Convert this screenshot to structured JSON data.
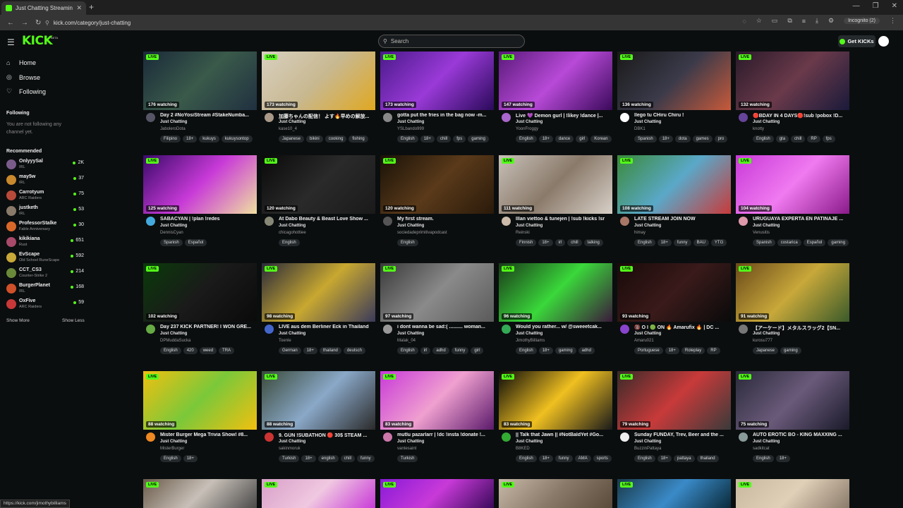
{
  "browser": {
    "tab_title": "Just Chatting Streaming - Live",
    "url": "kick.com/category/just-chatting",
    "incognito": "Incognito (2)",
    "status_url": "https://kick.com/jimothybilliams"
  },
  "header": {
    "logo": "KICK",
    "beta": "BETA",
    "search_placeholder": "Search",
    "get_kicks": "Get KICKs"
  },
  "sidebar": {
    "nav": [
      {
        "label": "Home",
        "icon": "home-icon",
        "glyph": "⌂"
      },
      {
        "label": "Browse",
        "icon": "browse-icon",
        "glyph": "◎"
      },
      {
        "label": "Following",
        "icon": "heart-icon",
        "glyph": "♡"
      }
    ],
    "following_title": "Following",
    "following_empty": "You are not following any channel yet.",
    "recommended_title": "Recommended",
    "recommended": [
      {
        "name": "OnlyyySal",
        "category": "IRL",
        "viewers": "2K",
        "color": "#7a5c8a"
      },
      {
        "name": "may5w",
        "category": "IRL",
        "viewers": "37",
        "color": "#c9892c"
      },
      {
        "name": "Carrotyum",
        "category": "ARC Raiders",
        "viewers": "75",
        "color": "#b84a3a"
      },
      {
        "name": "justketh",
        "category": "IRL",
        "viewers": "53",
        "color": "#8a7a6a"
      },
      {
        "name": "ProfessorStalke",
        "category": "Fable Anniversary",
        "viewers": "30",
        "color": "#d8682a"
      },
      {
        "name": "kikikiana",
        "category": "Rust",
        "viewers": "651",
        "color": "#a84a6a"
      },
      {
        "name": "EvScape",
        "category": "Old School RuneScape",
        "viewers": "592",
        "color": "#c8a838"
      },
      {
        "name": "CCT_CS3",
        "category": "Counter-Strike 2",
        "viewers": "214",
        "color": "#6a8a3a"
      },
      {
        "name": "BurgerPlanet",
        "category": "IRL",
        "viewers": "168",
        "color": "#d0502a"
      },
      {
        "name": "OxFive",
        "category": "ARC Raiders",
        "viewers": "59",
        "color": "#c83838"
      }
    ],
    "show_more": "Show More",
    "show_less": "Show Less"
  },
  "labels": {
    "live": "LIVE"
  },
  "streams": [
    {
      "watching": "176 watching",
      "title": "Day 2 #NoYosiStream #StakeNumba...",
      "category": "Just Chatting",
      "channel": "JaboleroDota",
      "tags": [
        "Filipino",
        "18+",
        "kukuys",
        "kukuysontop"
      ],
      "bg": "linear-gradient(135deg,#1a2a3a,#3a5a4a 50%,#203040)",
      "av": "#556"
    },
    {
      "watching": "173 watching",
      "title": "加藤ちゃんの配信！ よす🔥早めの解放...",
      "category": "Just Chatting",
      "channel": "kase10_4",
      "tags": [
        "Japanese",
        "bikini",
        "cooking",
        "fishing"
      ],
      "bg": "linear-gradient(135deg,#d8d0c0,#c8b890 50%,#e0a820)",
      "av": "#a98"
    },
    {
      "watching": "173 watching",
      "title": "gotta put the fries in the bag now -m...",
      "category": "Just Chatting",
      "channel": "YSLbando999",
      "tags": [
        "English",
        "18+",
        "chill",
        "fps",
        "gaming"
      ],
      "bg": "linear-gradient(135deg,#4a1a8a,#9a3ad8 50%,#2a0a5a)",
      "av": "#888"
    },
    {
      "watching": "147 watching",
      "title": "Live 💜 Demon gurl | !likey !dance |...",
      "category": "Just Chatting",
      "channel": "YoonFroggy",
      "tags": [
        "English",
        "18+",
        "dance",
        "girl",
        "Korean"
      ],
      "bg": "linear-gradient(135deg,#5a1a7a,#b84ad8 50%,#3a0a5a)",
      "av": "#a6c"
    },
    {
      "watching": "136 watching",
      "title": "llego tu CHiru Chiru !",
      "category": "Just Chatting",
      "channel": "DBK1",
      "tags": [
        "Spanish",
        "18+",
        "dota",
        "games",
        "pro"
      ],
      "bg": "linear-gradient(135deg,#1a1a1a,#3a3a4a 50%,#c85a3a)",
      "av": "#fff"
    },
    {
      "watching": "132 watching",
      "title": "🔴BDAY IN 4 DAYS🔴!sub !pobox !D...",
      "category": "Just Chatting",
      "channel": "knotty",
      "tags": [
        "English",
        "gta",
        "chill",
        "RP",
        "fps"
      ],
      "bg": "linear-gradient(135deg,#2a1a2a,#6a3a4a 50%,#1a1a3a)",
      "av": "#649"
    },
    {
      "watching": "125 watching",
      "title": "SABACYAN | !plan !redes",
      "category": "Just Chatting",
      "channel": "DennisCyan",
      "tags": [
        "Spanish",
        "Español"
      ],
      "bg": "linear-gradient(135deg,#3a0a6a,#c83ad8 50%,#f0e0a0)",
      "av": "#4ad"
    },
    {
      "watching": "120 watching",
      "title": "At Dabo Beauty & Beast Love Show ...",
      "category": "Just Chatting",
      "channel": "chicagohottiee",
      "tags": [
        "English"
      ],
      "bg": "linear-gradient(135deg,#0a0a0a,#2a2a2a 50%,#1a1a1a)",
      "av": "#887"
    },
    {
      "watching": "120 watching",
      "title": "My first stream.",
      "category": "Just Chatting",
      "channel": "sociedadeprimitivapodcast",
      "tags": [
        "English"
      ],
      "bg": "linear-gradient(135deg,#1a1208,#5a3a1a 50%,#2a1a0a)",
      "av": "#555"
    },
    {
      "watching": "111 watching",
      "title": "Illan viettoo & tunejen | !sub !kicks !sr",
      "category": "Just Chatting",
      "channel": "Reinski",
      "tags": [
        "Finnish",
        "18+",
        "irl",
        "chill",
        "talking"
      ],
      "bg": "linear-gradient(135deg,#c8c0b8,#8a7a6a 50%,#d8d0c8)",
      "av": "#cba"
    },
    {
      "watching": "108 watching",
      "title": "LATE STREAM JOIN NOW",
      "category": "Just Chatting",
      "channel": "himay",
      "tags": [
        "English",
        "18+",
        "funny",
        "BAU",
        "YTG"
      ],
      "bg": "linear-gradient(135deg,#3a8a3a,#5aa8c8 50%,#c83a3a)",
      "av": "#a76"
    },
    {
      "watching": "104 watching",
      "title": "URUGUAYA EXPERTA EN PATINAJE ...",
      "category": "Just Chatting",
      "channel": "Venusitis",
      "tags": [
        "Spanish",
        "costarica",
        "Español",
        "gaming"
      ],
      "bg": "linear-gradient(135deg,#c83ad8,#f07af0 50%,#8a1a8a)",
      "av": "#d9a"
    },
    {
      "watching": "102 watching",
      "title": "Day 237 KICK PARTNER! I WON GRE...",
      "category": "Just Chatting",
      "channel": "DPMuddaSucka",
      "tags": [
        "English",
        "420",
        "weed",
        "TRA"
      ],
      "bg": "linear-gradient(135deg,#0a3a0a,#1a1a1a 50%,#0a0a0a)",
      "av": "#6a4"
    },
    {
      "watching": "98 watching",
      "title": "LIVE aus dem Berliner Eck in Thailand",
      "category": "Just Chatting",
      "channel": "Toenle",
      "tags": [
        "German",
        "18+",
        "thailand",
        "deutsch"
      ],
      "bg": "linear-gradient(135deg,#2a2a3a,#c8a830 50%,#3a3a5a)",
      "av": "#46c"
    },
    {
      "watching": "97 watching",
      "title": "i dont wanna be sad:( .......... woman...",
      "category": "Just Chatting",
      "channel": "Malak_04",
      "tags": [
        "English",
        "irl",
        "adhd",
        "funny",
        "girl"
      ],
      "bg": "linear-gradient(135deg,#3a3a3a,#8a8a8a 50%,#5a5a5a)",
      "av": "#999"
    },
    {
      "watching": "96 watching",
      "title": "Would you rather... w/ @sweeetcak...",
      "category": "Just Chatting",
      "channel": "JimothyBilliams",
      "tags": [
        "English",
        "18+",
        "gaming",
        "adhd"
      ],
      "bg": "linear-gradient(135deg,#1a3a1a,#3ad83a 50%,#3a1a3a)",
      "av": "#3a5"
    },
    {
      "watching": "93 watching",
      "title": "🔞 O I 🟢 ON 🔥 Amarufix 🔥 | DC ...",
      "category": "Just Chatting",
      "channel": "Amaru021",
      "tags": [
        "Portuguese",
        "18+",
        "Roleplay",
        "RP"
      ],
      "bg": "linear-gradient(135deg,#1a0a0a,#3a1a1a 50%,#0a0a0a)",
      "av": "#84c"
    },
    {
      "watching": "91 watching",
      "title": "【アーケード】メタルスラッグ2【SN...",
      "category": "Just Chatting",
      "channel": "kurosu777",
      "tags": [
        "Japanese",
        "gaming"
      ],
      "bg": "linear-gradient(135deg,#6a4a1a,#c8a83a 50%,#3a5a2a)",
      "av": "#777"
    },
    {
      "watching": "88 watching",
      "title": "Mister Burger Mega Trivia Show! #8...",
      "category": "Just Chatting",
      "channel": "MisterBurger",
      "tags": [
        "English",
        "18+"
      ],
      "bg": "linear-gradient(135deg,#f0c010,#7ac83a 50%,#f0c010)",
      "av": "#e82"
    },
    {
      "watching": "88 watching",
      "title": "9. GÜN !SUBATHON 🔴 30$ STEAM ...",
      "category": "Just Chatting",
      "channel": "sakinmoruk",
      "tags": [
        "Turkish",
        "18+",
        "english",
        "chill",
        "funny"
      ],
      "bg": "linear-gradient(135deg,#3a4a3a,#8aa8c8 50%,#2a2a2a)",
      "av": "#c33"
    },
    {
      "watching": "83 watching",
      "title": "mutlu pazarlarr | !dc !insta !donate !...",
      "category": "Just Chatting",
      "channel": "vantesaint",
      "tags": [
        "Turkish"
      ],
      "bg": "linear-gradient(135deg,#c83ad8,#f0a0d0 50%,#5a1a6a)",
      "av": "#c7a"
    },
    {
      "watching": "83 watching",
      "title": "|| Talk that Jawn || #NotBaldYet #Go...",
      "category": "Just Chatting",
      "channel": "B8KED",
      "tags": [
        "English",
        "18+",
        "funny",
        "AMA",
        "sports"
      ],
      "bg": "linear-gradient(135deg,#0a0a0a,#f0c020 50%,#1a1a1a)",
      "av": "#3a3"
    },
    {
      "watching": "79 watching",
      "title": "Sunday FUNDAY, Trev, Beer and the ...",
      "category": "Just Chatting",
      "channel": "BuzzinPattaya",
      "tags": [
        "English",
        "18+",
        "pattaya",
        "thailand"
      ],
      "bg": "linear-gradient(135deg,#3a2a2a,#c83a3a 50%,#3a3a3a)",
      "av": "#eee"
    },
    {
      "watching": "75 watching",
      "title": "AUTO EROTIC BO - KING MAXXING ...",
      "category": "Just Chatting",
      "channel": "sadkitcat",
      "tags": [
        "English",
        "18+"
      ],
      "bg": "linear-gradient(135deg,#2a2a3a,#6a5a7a 50%,#1a1a2a)",
      "av": "#899"
    },
    {
      "watching": "",
      "title": "",
      "category": "",
      "channel": "",
      "tags": [],
      "bg": "linear-gradient(135deg,#6a5a4a,#c8c0b8 50%,#4a4a4a)",
      "av": "#000"
    },
    {
      "watching": "",
      "title": "",
      "category": "",
      "channel": "",
      "tags": [],
      "bg": "linear-gradient(135deg,#d8a0c8,#f0c8e0 50%,#c83ad8)",
      "av": "#000"
    },
    {
      "watching": "",
      "title": "",
      "category": "",
      "channel": "",
      "tags": [],
      "bg": "linear-gradient(135deg,#8a1ad8,#c83ad8 50%,#3a0a5a)",
      "av": "#000"
    },
    {
      "watching": "",
      "title": "",
      "category": "",
      "channel": "",
      "tags": [],
      "bg": "linear-gradient(135deg,#c8b8a8,#8a7a6a 50%,#5a4a3a)",
      "av": "#000"
    },
    {
      "watching": "",
      "title": "",
      "category": "",
      "channel": "",
      "tags": [],
      "bg": "linear-gradient(135deg,#1a3a4a,#3a8ac8 50%,#0a2a3a)",
      "av": "#000"
    },
    {
      "watching": "",
      "title": "",
      "category": "",
      "channel": "",
      "tags": [],
      "bg": "linear-gradient(135deg,#c8b8a0,#e0d0b8 50%,#8a7a6a)",
      "av": "#000"
    }
  ]
}
